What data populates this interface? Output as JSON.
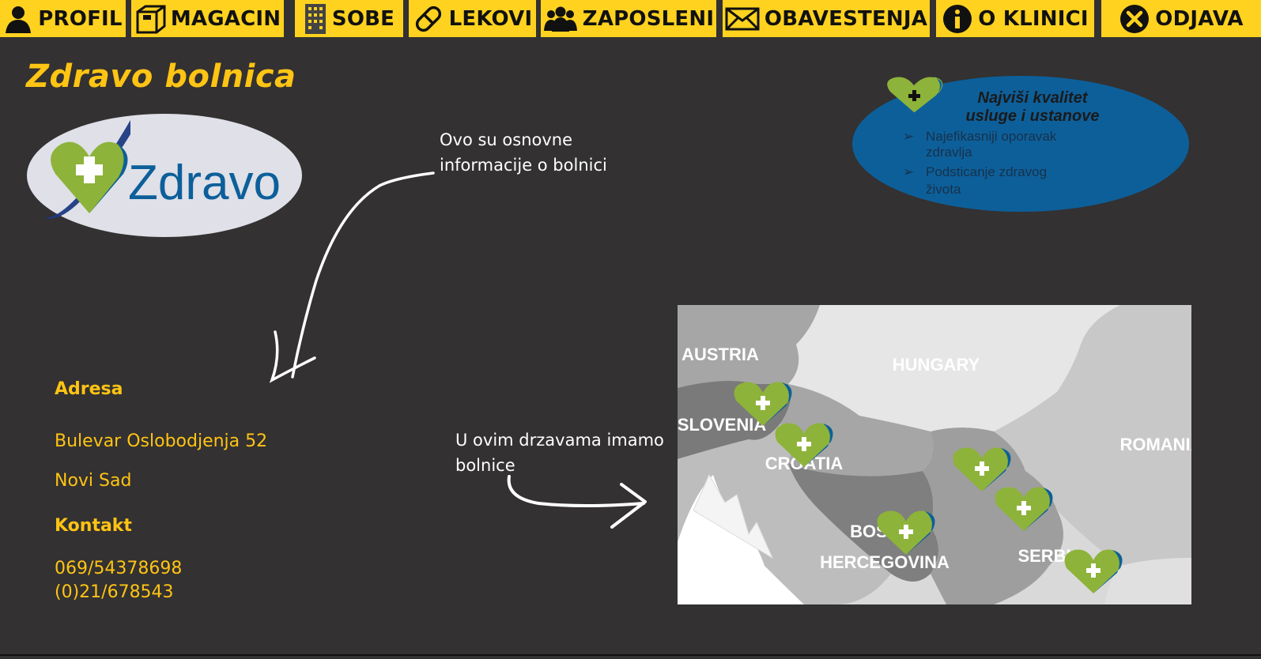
{
  "nav": [
    {
      "label": "PROFIL",
      "icon": "person-icon"
    },
    {
      "label": "MAGACIN",
      "icon": "box-icon"
    },
    {
      "label": "SOBE",
      "icon": "building-icon"
    },
    {
      "label": "LEKOVI",
      "icon": "pill-icon"
    },
    {
      "label": "ZAPOSLENI",
      "icon": "group-icon"
    },
    {
      "label": "OBAVESTENJA",
      "icon": "envelope-icon"
    },
    {
      "label": "O KLINICI",
      "icon": "info-icon"
    },
    {
      "label": "ODJAVA",
      "icon": "close-circle-icon"
    }
  ],
  "page": {
    "title": "Zdravo bolnica"
  },
  "logo": {
    "text": "Zdravo"
  },
  "notes": {
    "info": [
      "Ovo su osnovne",
      "informacije o bolnici"
    ],
    "countries": [
      "U ovim drzavama imamo",
      "bolnice"
    ]
  },
  "address": {
    "heading": "Adresa",
    "street": "Bulevar Oslobodjenja 52",
    "city": "Novi Sad"
  },
  "contact": {
    "heading": "Kontakt",
    "phone1": "069/54378698",
    "phone2": "(0)21/678543"
  },
  "quality": {
    "title1": "Najviši kvalitet",
    "title2": "usluge i ustanove",
    "item1a": "Najefikasniji oporavak",
    "item1b": "zdravlja",
    "item2a": "Podsticanje zdravog",
    "item2b": "života"
  },
  "map": {
    "austria": "AUSTRIA",
    "hungary": "HUNGARY",
    "slovenia": "SLOVENIA",
    "croatia": "CROATIA",
    "romania": "ROMANIA",
    "bosnia1": "BOS",
    "bosnia2": "HERCEGOVINA",
    "serbia": "SERBIA"
  },
  "colors": {
    "nav_bg": "#ffd21f",
    "page_bg": "#333131",
    "accent": "#ffc414",
    "brand_green": "#8db33a",
    "brand_blue": "#0d5f9a"
  }
}
